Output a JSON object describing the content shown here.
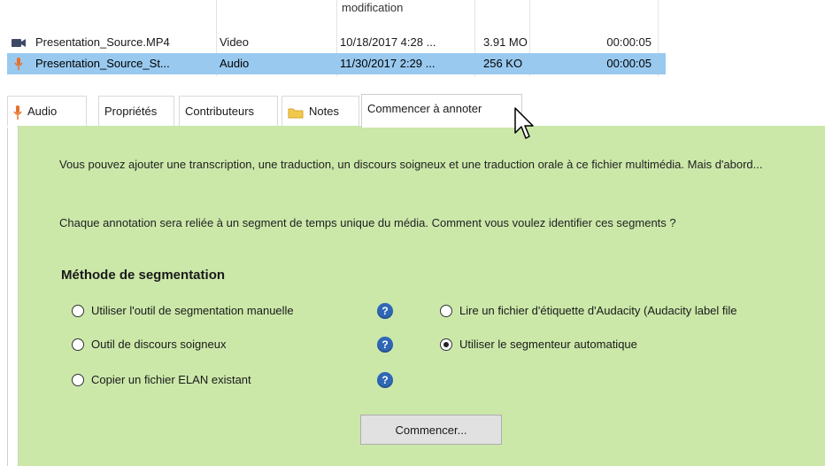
{
  "table": {
    "header_fragments": {
      "type": "",
      "date": "modification"
    },
    "rows": [
      {
        "name": "Presentation_Source.MP4",
        "type": "Video",
        "date": "10/18/2017 4:28 ...",
        "size": "3.91 MO",
        "duration": "00:00:05",
        "icon": "video-camera-icon",
        "selected": false
      },
      {
        "name": "Presentation_Source_St...",
        "type": "Audio",
        "date": "11/30/2017 2:29 ...",
        "size": "256 KO",
        "duration": "00:00:05",
        "icon": "microphone-icon",
        "selected": true
      }
    ]
  },
  "tabs": [
    {
      "label": "Audio",
      "icon": "microphone-icon"
    },
    {
      "label": "Propriétés"
    },
    {
      "label": "Contributeurs"
    },
    {
      "label": "Notes",
      "icon": "folder-icon"
    },
    {
      "label": "Commencer à annoter",
      "active": true
    }
  ],
  "panel": {
    "intro": "Vous pouvez ajouter une transcription, une traduction, un discours soigneux et une traduction orale à ce fichier multimédia. Mais d'abord...",
    "question": "Chaque annotation sera reliée à un segment de temps unique du média. Comment vous voulez identifier ces segments ?",
    "section_title": "Méthode de segmentation",
    "options": {
      "manual": {
        "label": "Utiliser l'outil de segmentation manuelle",
        "checked": false
      },
      "careful": {
        "label": "Outil de discours soigneux",
        "checked": false
      },
      "copy_elan": {
        "label": "Copier un fichier ELAN existant",
        "checked": false
      },
      "audacity": {
        "label": "Lire un fichier d'étiquette d'Audacity (Audacity label file",
        "checked": false
      },
      "auto": {
        "label": "Utiliser le segmenteur automatique",
        "checked": true
      }
    },
    "help_symbol": "?",
    "start_button": "Commencer..."
  },
  "colors": {
    "panel_bg": "#cbe8a9",
    "selection": "#99c9ef",
    "help": "#2f67b6",
    "mic": "#e8702a"
  }
}
